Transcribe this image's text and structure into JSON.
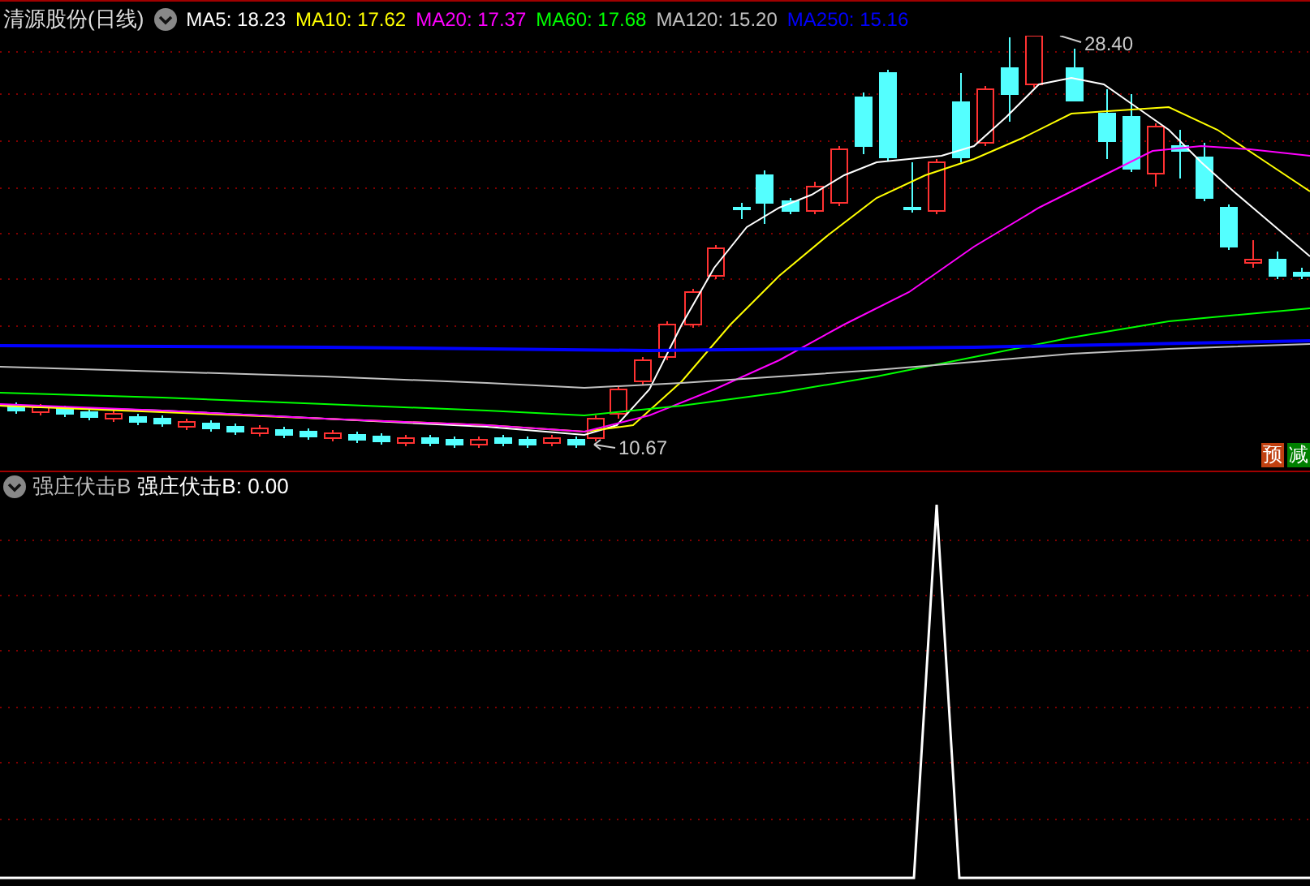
{
  "main_panel": {
    "stock_name": "清源股份(日线)",
    "indicators": [
      {
        "label": "MA5: 18.23",
        "color": "#ffffff"
      },
      {
        "label": "MA10: 17.62",
        "color": "#ffff00"
      },
      {
        "label": "MA20: 17.37",
        "color": "#ff00ff"
      },
      {
        "label": "MA60: 17.68",
        "color": "#00ff00"
      },
      {
        "label": "MA120: 15.20",
        "color": "#c0c0c0"
      },
      {
        "label": "MA250: 15.16",
        "color": "#0000ff"
      }
    ],
    "high_label": "28.40",
    "low_label": "10.67",
    "badges": [
      {
        "text": "预",
        "color": "#c04010"
      },
      {
        "text": "减",
        "color": "#008000"
      }
    ]
  },
  "sub_panel": {
    "indicator_name": "强庄伏击B",
    "reading": "强庄伏击B: 0.00"
  }
}
